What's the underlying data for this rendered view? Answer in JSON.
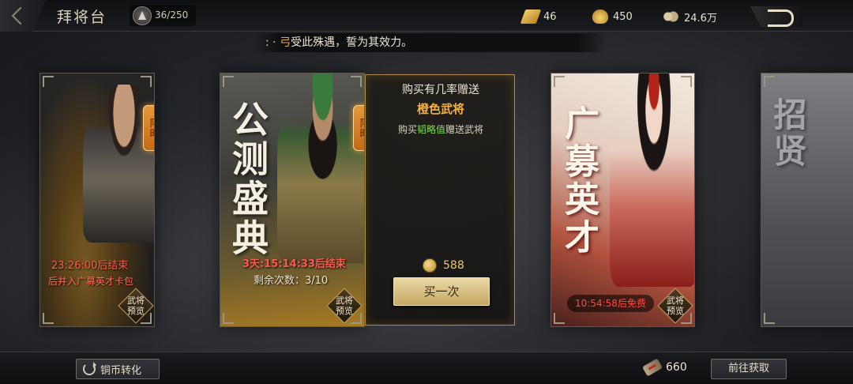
{
  "header": {
    "title": "拜将台",
    "rank_progress": "36/250",
    "resources": [
      {
        "icon": "ticket-icon",
        "value": "46"
      },
      {
        "icon": "gold-ingot-icon",
        "value": "450"
      },
      {
        "icon": "copper-coin-icon",
        "value": "24.6万"
      }
    ]
  },
  "marquee": {
    "prefix": ": ·",
    "name": "弓",
    "message": "受此殊遇，誓为其效力。"
  },
  "cards": {
    "left": {
      "limited_tag": "限时",
      "timer": "23:26:00后结束",
      "pack_info": "后并入广募英才卡包",
      "preview_label": "武将\n预览"
    },
    "center": {
      "calligraphy": "公测盛典",
      "limited_tag": "限时",
      "timer": "3天:15:14:33后结束",
      "remaining": "剩余次数：3/10",
      "preview_label": "武将\n预览"
    },
    "right": {
      "calligraphy": "广募英才",
      "free_timer": "10:54:58后免费",
      "preview_label": "武将\n预览"
    },
    "far": {
      "calligraphy": "招贤"
    }
  },
  "purchase_panel": {
    "title": "购买有几率赠送",
    "subtitle": "橙色武将",
    "desc_prefix": "购买",
    "desc_highlight": "韬略值",
    "desc_suffix": "赠送武将",
    "price": "588",
    "buy_button": "买一次"
  },
  "footer": {
    "convert_button": "铜币转化",
    "token_count": "660",
    "goto_button": "前往获取"
  },
  "colors": {
    "accent_gold": "#f4b241",
    "timer_red": "#ff5a4a",
    "highlight_green": "#7fdc4e"
  }
}
